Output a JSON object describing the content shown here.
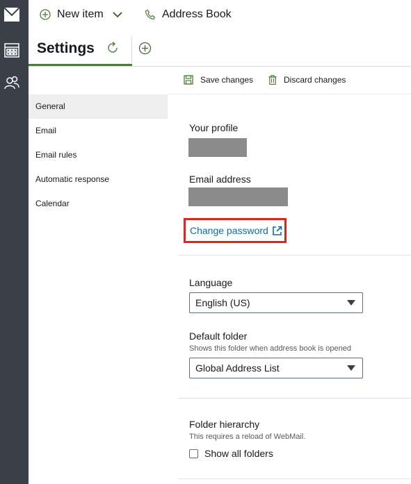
{
  "topbar": {
    "new_item_label": "New item",
    "address_book_label": "Address Book"
  },
  "settings": {
    "title": "Settings"
  },
  "actions": {
    "save_label": "Save changes",
    "discard_label": "Discard changes"
  },
  "nav": {
    "items": [
      {
        "label": "General"
      },
      {
        "label": "Email"
      },
      {
        "label": "Email rules"
      },
      {
        "label": "Automatic response"
      },
      {
        "label": "Calendar"
      }
    ]
  },
  "general": {
    "profile_label": "Your profile",
    "email_label": "Email address",
    "change_password_label": "Change password",
    "language_label": "Language",
    "language_value": "English (US)",
    "default_folder_label": "Default folder",
    "default_folder_hint": "Shows this folder when address book is opened",
    "default_folder_value": "Global Address List",
    "folder_hierarchy_label": "Folder hierarchy",
    "folder_hierarchy_hint": "This requires a reload of WebMail.",
    "show_all_folders_label": "Show all folders",
    "show_all_folders_checked": false
  },
  "colors": {
    "rail": "#3a3f4a",
    "accent_green": "#4b7a3c",
    "link_blue": "#0b6ca5",
    "highlight_red": "#e0241a"
  },
  "icons": [
    "mail-icon",
    "calendar-icon",
    "contacts-icon",
    "plus-circle-icon",
    "chevron-down-icon",
    "phone-icon",
    "refresh-icon",
    "add-tab-icon",
    "save-icon",
    "trash-icon",
    "external-link-icon"
  ]
}
